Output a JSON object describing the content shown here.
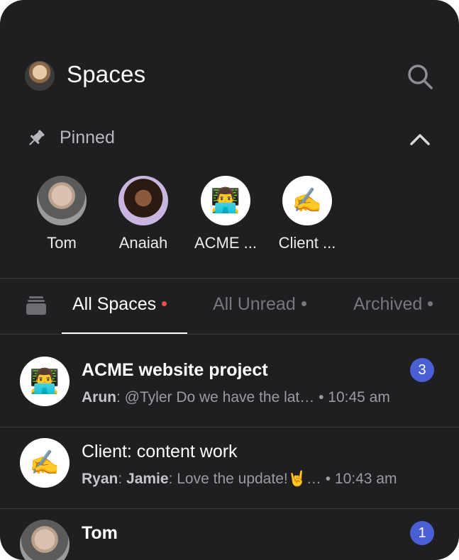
{
  "header": {
    "title": "Spaces"
  },
  "pinned": {
    "label": "Pinned",
    "items": [
      {
        "label": "Tom"
      },
      {
        "label": "Anaiah"
      },
      {
        "label": "ACME ...",
        "emoji": "👨‍💻"
      },
      {
        "label": "Client ...",
        "emoji": "✍️"
      }
    ]
  },
  "tabs": [
    {
      "label": "All Spaces"
    },
    {
      "label": "All Unread"
    },
    {
      "label": "Archived"
    }
  ],
  "spaces": [
    {
      "name": "ACME website project",
      "emoji": "👨‍💻",
      "sender": "Arun",
      "message": ": @Tyler Do we have the lat…",
      "time": " • 10:45 am",
      "unread": "3"
    },
    {
      "name": "Client: content work",
      "emoji": "✍️",
      "sender": "Ryan",
      "sep": ": ",
      "sender2": "Jamie",
      "message": ": Love the update!🤘… ",
      "time": " • 10:43 am"
    },
    {
      "name": "Tom",
      "unread": "1"
    }
  ],
  "colors": {
    "background": "#1f1f21",
    "accent": "#4a5fd4",
    "unread_dot": "#e0534a"
  }
}
